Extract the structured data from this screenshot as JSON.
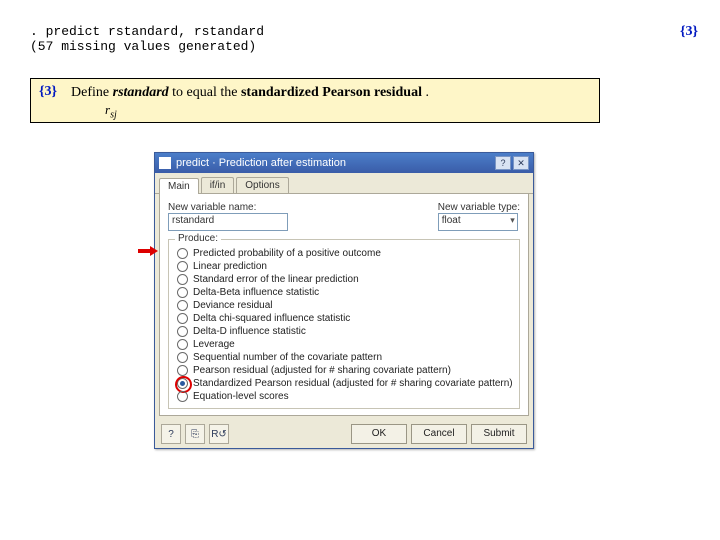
{
  "command": {
    "line1": ". predict rstandard, rstandard",
    "line2": "(57 missing values generated)"
  },
  "ref_top": "{3}",
  "callout": {
    "num": "{3}",
    "text_pre": "Define ",
    "text_var": "rstandard",
    "text_mid": " to equal the ",
    "text_bold": "standardized Pearson residual",
    "text_post": "    .",
    "sub": "r",
    "sub_sj": "sj"
  },
  "dialog": {
    "title": "predict · Prediction after estimation",
    "tabs": [
      "Main",
      "if/in",
      "Options"
    ],
    "varname_label": "New variable name:",
    "varname_value": "rstandard",
    "vartype_label": "New variable type:",
    "vartype_value": "float",
    "group_label": "Produce:",
    "options": [
      "Predicted probability of a positive outcome",
      "Linear prediction",
      "Standard error of the linear prediction",
      "Delta-Beta influence statistic",
      "Deviance residual",
      "Delta chi-squared influence statistic",
      "Delta-D influence statistic",
      "Leverage",
      "Sequential number of the covariate pattern",
      "Pearson residual (adjusted for # sharing covariate pattern)",
      "Standardized Pearson residual (adjusted for # sharing covariate pattern)",
      "Equation-level scores"
    ],
    "selected_index": 10,
    "buttons": {
      "ok": "OK",
      "cancel": "Cancel",
      "submit": "Submit"
    },
    "iconbtn": {
      "help": "?",
      "copy": "⎘",
      "reset": "R↺"
    }
  }
}
